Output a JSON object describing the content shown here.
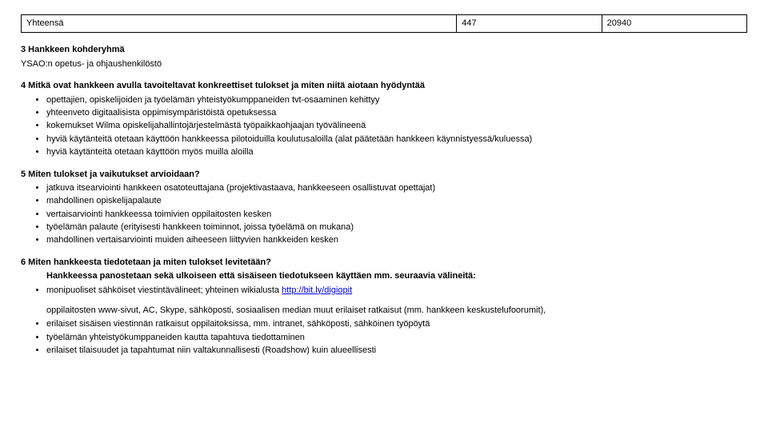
{
  "totalsRow": {
    "label": "Yhteensä",
    "col2": "447",
    "col3": "20940"
  },
  "section3": {
    "heading": "3 Hankkeen kohderyhmä",
    "body": "YSAO:n opetus- ja ohjaushenkilöstö"
  },
  "section4": {
    "heading": "4 Mitkä ovat hankkeen avulla tavoiteltavat konkreettiset tulokset ja miten niitä aiotaan hyödyntää",
    "items": [
      "opettajien, opiskelijoiden ja työelämän yhteistyökumppaneiden tvt-osaaminen kehittyy",
      "yhteenveto digitaalisista oppimisympäristöistä opetuksessa",
      "kokemukset Wilma opiskelijahallintojärjestelmästä työpaikkaohjaajan työvälineenä",
      "hyviä käytänteitä otetaan käyttöön hankkeessa pilotoiduilla koulutusaloilla (alat päätetään hankkeen käynnistyessä/kuluessa)",
      "hyviä käytänteitä otetaan käyttöön myös muilla aloilla"
    ]
  },
  "section5": {
    "heading": "5 Miten tulokset ja vaikutukset arvioidaan?",
    "items": [
      "jatkuva itsearviointi hankkeen osatoteuttajana (projektivastaava, hankkeeseen osallistuvat opettajat)",
      "mahdollinen opiskelijapalaute",
      "vertaisarviointi hankkeessa toimivien oppilaitosten kesken",
      "työelämän palaute (erityisesti hankkeen toiminnot, joissa työelämä on mukana)",
      "mahdollinen vertaisarviointi muiden aiheeseen liittyvien hankkeiden kesken"
    ]
  },
  "section6": {
    "heading": "6 Miten hankkeesta tiedotetaan ja miten tulokset levitetään?",
    "intro": "Hankkeessa panostetaan sekä ulkoiseen että sisäiseen tiedotukseen käyttäen mm. seuraavia välineitä:",
    "item1_prefix": "monipuoliset sähköiset viestintävälineet; yhteinen wikialusta ",
    "item1_link_text": "http://bit.ly/digiopit",
    "item1_href": "http://bit.ly/digiopit",
    "sub1": "oppilaitosten www-sivut, AC, Skype, sähköposti, sosiaalisen median muut erilaiset ratkaisut (mm. hankkeen keskustelufoorumit),",
    "item2": "erilaiset sisäisen viestinnän ratkaisut oppilaitoksissa, mm. intranet, sähköposti, sähköinen työpöytä",
    "item3": "työelämän yhteistyökumppaneiden kautta tapahtuva tiedottaminen",
    "item4": "erilaiset tilaisuudet ja tapahtumat niin valtakunnallisesti (Roadshow) kuin alueellisesti"
  }
}
